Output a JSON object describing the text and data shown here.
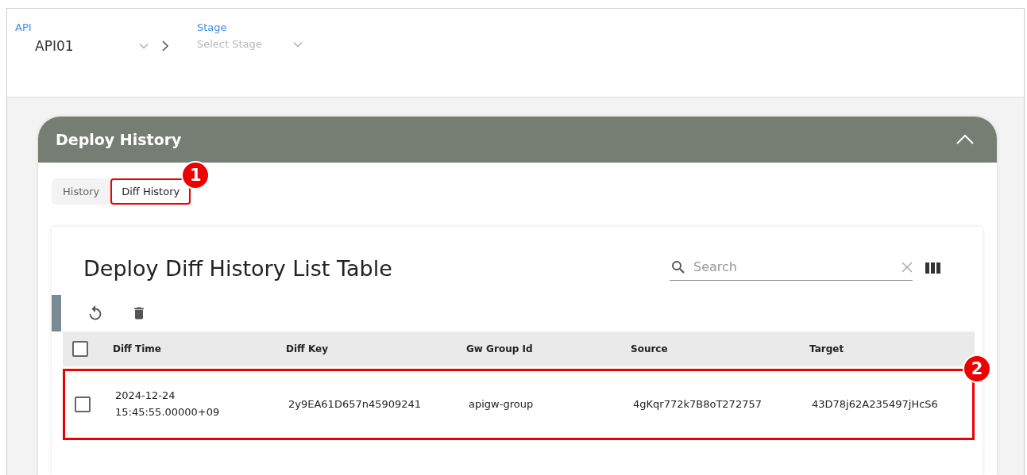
{
  "selectors": {
    "api": {
      "label": "API",
      "value": "API01"
    },
    "stage": {
      "label": "Stage",
      "placeholder": "Select Stage"
    }
  },
  "panel": {
    "title": "Deploy History",
    "expanded": true,
    "tabs": [
      {
        "label": "History",
        "selected": false
      },
      {
        "label": "Diff History",
        "selected": true,
        "callout": "1"
      }
    ],
    "table": {
      "title": "Deploy Diff History List Table",
      "search": {
        "placeholder": "Search"
      },
      "columns": [
        "Diff Time",
        "Diff Key",
        "Gw Group Id",
        "Source",
        "Target"
      ],
      "all_checked": false,
      "rows": [
        {
          "checked": false,
          "callout": "2",
          "cells": [
            "2024-12-24\n15:45:55.00000+09",
            "2y9EA61D657n45909241",
            "apigw-group",
            "4gKqr772k7B8oT272757",
            "43D78j62A235497jHcS6"
          ]
        }
      ]
    }
  }
}
